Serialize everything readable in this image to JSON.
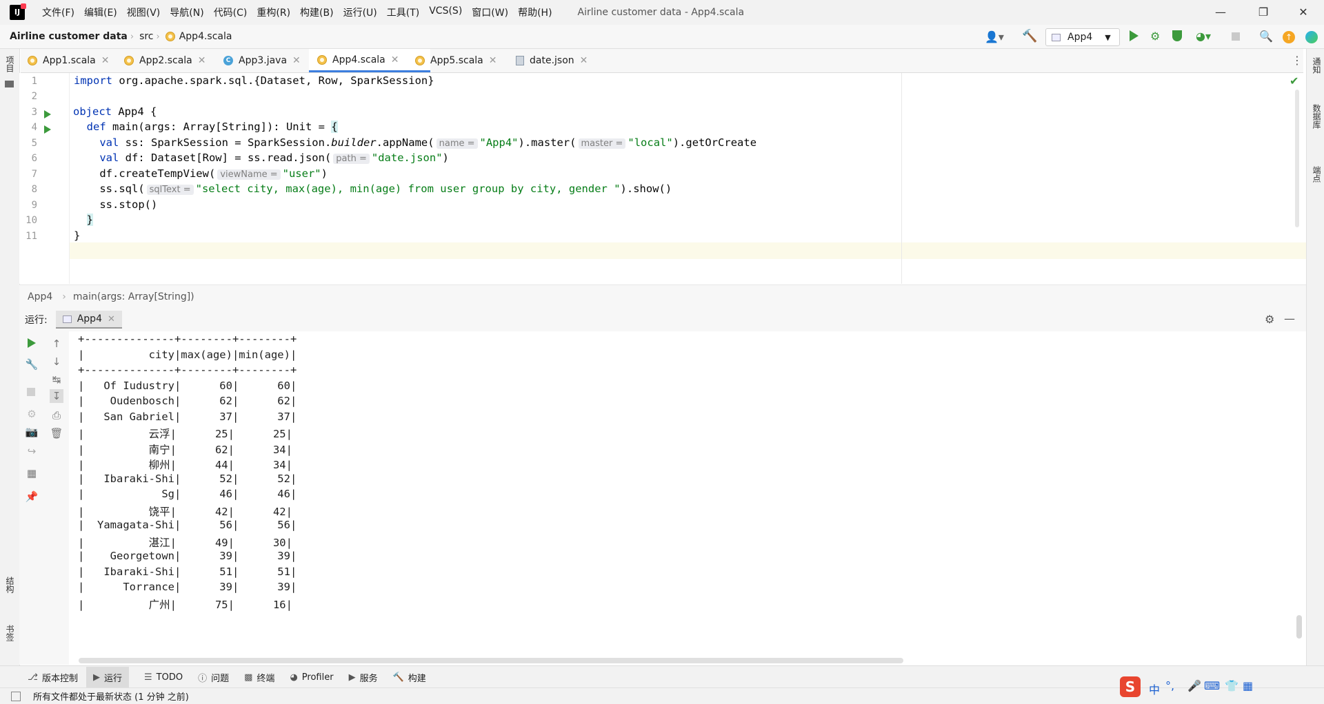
{
  "titlebar": {
    "menu": [
      "文件(F)",
      "编辑(E)",
      "视图(V)",
      "导航(N)",
      "代码(C)",
      "重构(R)",
      "构建(B)",
      "运行(U)",
      "工具(T)",
      "VCS(S)",
      "窗口(W)",
      "帮助(H)"
    ],
    "window_title": "Airline customer data - App4.scala"
  },
  "navbar": {
    "project": "Airline customer data",
    "src": "src",
    "file": "App4.scala",
    "run_config": "App4"
  },
  "tabs": [
    {
      "label": "App1.scala",
      "icon": "scala-icon"
    },
    {
      "label": "App2.scala",
      "icon": "scala-icon"
    },
    {
      "label": "App3.java",
      "icon": "java-class-icon"
    },
    {
      "label": "App4.scala",
      "icon": "scala-icon",
      "active": true
    },
    {
      "label": "App5.scala",
      "icon": "scala-icon"
    },
    {
      "label": "date.json",
      "icon": "json-icon"
    }
  ],
  "left_strip": {
    "project": "项目",
    "structure": "结构",
    "bookmarks": "书签"
  },
  "right_strip": {
    "notifications": "通知",
    "database": "数据库",
    "endpoints": "端点"
  },
  "editor": {
    "line_numbers": [
      "1",
      "2",
      "3",
      "4",
      "5",
      "6",
      "7",
      "8",
      "9",
      "10",
      "11"
    ],
    "l1": {
      "kw": "import",
      "rest": " org.apache.spark.sql.{Dataset, Row, SparkSession}"
    },
    "l3": {
      "kw": "object",
      "rest": " App4 {"
    },
    "l4": {
      "indent": "  ",
      "kw": "def",
      "rest": " main(args: Array[String]): Unit = ",
      "brace": "{"
    },
    "l5": {
      "indent": "    ",
      "kw": "val",
      "a": " ss: SparkSession = SparkSession.",
      "b": "builder",
      "c": ".appName(",
      "hint1": "name =",
      "s1": "\"App4\"",
      "d": ").master(",
      "hint2": "master =",
      "s2": "\"local\"",
      "e": ").getOrCreate"
    },
    "l6": {
      "indent": "    ",
      "kw": "val",
      "a": " df: Dataset[Row] = ss.read.json(",
      "hint": "path =",
      "s": "\"date.json\"",
      "b": ")"
    },
    "l7": {
      "indent": "    ",
      "a": "df.createTempView(",
      "hint": "viewName =",
      "s": "\"user\"",
      "b": ")"
    },
    "l8": {
      "indent": "    ",
      "a": "ss.sql(",
      "hint": "sqlText =",
      "s": "\"select city, max(age), min(age) from user group by city, gender \"",
      "b": ").show()"
    },
    "l9": {
      "indent": "    ",
      "a": "ss.stop()"
    },
    "l10": {
      "indent": "  ",
      "a": "}"
    },
    "l11": {
      "a": "}"
    }
  },
  "breadcrumb2": {
    "object": "App4",
    "method": "main(args: Array[String])"
  },
  "run_panel": {
    "label": "运行:",
    "tab": "App4"
  },
  "console_lines": [
    "+--------------+--------+--------+",
    "|          city|max(age)|min(age)|",
    "+--------------+--------+--------+",
    "|   Of Iudustry|      60|      60|",
    "|    Oudenbosch|      62|      62|",
    "|   San Gabriel|      37|      37|",
    "|          云浮|      25|      25|",
    "|          南宁|      62|      34|",
    "|          柳州|      44|      34|",
    "|   Ibaraki-Shi|      52|      52|",
    "|            Sg|      46|      46|",
    "|          饶平|      42|      42|",
    "|  Yamagata-Shi|      56|      56|",
    "|          湛江|      49|      30|",
    "|    Georgetown|      39|      39|",
    "|   Ibaraki-Shi|      51|      51|",
    "|      Torrance|      39|      39|",
    "|          广州|      75|      16|"
  ],
  "bottom_tabs": [
    {
      "label": "版本控制",
      "icon": "vcs-icon"
    },
    {
      "label": "运行",
      "icon": "run-icon",
      "selected": true
    },
    {
      "label": "TODO",
      "icon": "todo-icon"
    },
    {
      "label": "问题",
      "icon": "problems-icon"
    },
    {
      "label": "终端",
      "icon": "terminal-icon"
    },
    {
      "label": "Profiler",
      "icon": "profiler-icon"
    },
    {
      "label": "服务",
      "icon": "services-icon"
    },
    {
      "label": "构建",
      "icon": "build-icon"
    }
  ],
  "status": {
    "text": "所有文件都处于最新状态 (1 分钟 之前)"
  },
  "ime": {
    "lang": "中",
    "punct": "°,"
  },
  "colors": {
    "accent": "#3c7ede",
    "run_green": "#3c9a3c",
    "keyword": "#0033b3",
    "string": "#067d17"
  }
}
